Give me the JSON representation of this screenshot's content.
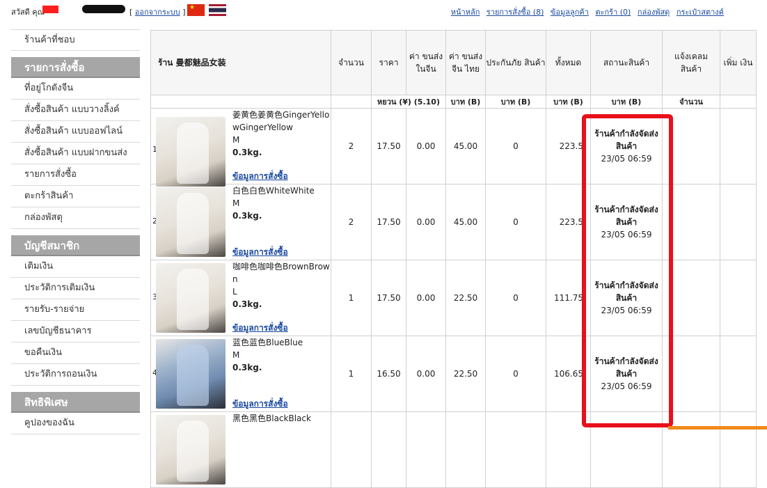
{
  "topbar": {
    "greeting": "สวัสดี คุณ",
    "logout_open": "[ ",
    "logout_label": "ออกจากระบบ",
    "logout_close": " ]",
    "nav": [
      {
        "label": "หน้าหลัก"
      },
      {
        "label": "รายการสั่งซื้อ (8)"
      },
      {
        "label": "ข้อมูลลูกค้า"
      },
      {
        "label": "ตะกร้า (0)"
      },
      {
        "label": "กล่องพัสดุ"
      },
      {
        "label": "กระเป๋าสตางค์"
      }
    ],
    "flags": [
      "china-flag-icon",
      "thailand-flag-icon"
    ],
    "redaction_color": "#ff1e1e"
  },
  "sidebar": {
    "top_item": "ร้านค้าที่ชอบ",
    "sections": [
      {
        "title": "รายการสั่งซื้อ",
        "items": [
          "ที่อยู่โกดังจีน",
          "สั่งซื้อสินค้า แบบวางลิ้งค์",
          "สั่งซื้อสินค้า แบบออฟไลน์",
          "สั่งซื้อสินค้า แบบฝากขนส่ง",
          "รายการสั่งซื้อ",
          "ตะกร้าสินค้า",
          "กล่องพัสดุ"
        ]
      },
      {
        "title": "บัญชีสมาชิก",
        "items": [
          "เติมเงิน",
          "ประวัติการเติมเงิน",
          "รายรับ-รายจ่าย",
          "เลขบัญชีธนาคาร",
          "ขอคืนเงิน",
          "ประวัติการถอนเงิน"
        ]
      },
      {
        "title": "สิทธิพิเศษ",
        "items": [
          "คูปองของฉัน"
        ]
      }
    ]
  },
  "table": {
    "shop_label": "ร้าน 曼都魅品女装",
    "headers": {
      "qty": "จำนวน",
      "price": "ราคา",
      "cn_ship": "ค่า ขนส่ง ในจีน",
      "th_ship": "ค่า ขนส่ง จีน ไทย",
      "insurance": "ประกันภัย สินค้า",
      "total": "ทั้งหมด",
      "status": "สถานะสินค้า",
      "claim": "แจ้งเคลม สินค้า",
      "topup": "เพิ่ม เงิน"
    },
    "units": {
      "price": "หยวน (¥) (5.10)",
      "th_ship": "บาท (B)",
      "insurance": "บาท (B)",
      "total": "บาท (B)",
      "status": "บาท (B)",
      "claim": "จำนวน"
    },
    "detail_link": "ข้อมูลการสั่งซื้อ",
    "rows": [
      {
        "index": "1",
        "name": "姜黄色姜黄色GingerYellowGingerYellow",
        "size": "M",
        "weight": "0.3kg.",
        "qty": "2",
        "price": "17.50",
        "cn_ship": "0.00",
        "th_ship": "45.00",
        "insurance": "0",
        "total": "223.5",
        "status": "ร้านค้ากำลังจัดส่งสินค้า",
        "status_time": "23/05 06:59"
      },
      {
        "index": "2",
        "name": "白色白色WhiteWhite",
        "size": "M",
        "weight": "0.3kg.",
        "qty": "2",
        "price": "17.50",
        "cn_ship": "0.00",
        "th_ship": "45.00",
        "insurance": "0",
        "total": "223.5",
        "status": "ร้านค้ากำลังจัดส่งสินค้า",
        "status_time": "23/05 06:59"
      },
      {
        "index": "3",
        "name": "咖啡色咖啡色BrownBrown",
        "size": "L",
        "weight": "0.3kg.",
        "qty": "1",
        "price": "17.50",
        "cn_ship": "0.00",
        "th_ship": "22.50",
        "insurance": "0",
        "total": "111.75",
        "status": "ร้านค้ากำลังจัดส่งสินค้า",
        "status_time": "23/05 06:59"
      },
      {
        "index": "4",
        "name": "蓝色蓝色BlueBlue",
        "size": "M",
        "weight": "0.3kg.",
        "qty": "1",
        "price": "16.50",
        "cn_ship": "0.00",
        "th_ship": "22.50",
        "insurance": "0",
        "total": "106.65",
        "status": "ร้านค้ากำลังจัดส่งสินค้า",
        "status_time": "23/05 06:59"
      }
    ],
    "partial_row_name": "黑色黑色BlackBlack"
  },
  "colors": {
    "link": "#1a4aa0",
    "sidebar_header": "#a6a6a6",
    "highlight": "#e8101a",
    "orange_bar": "#f08a1c"
  }
}
